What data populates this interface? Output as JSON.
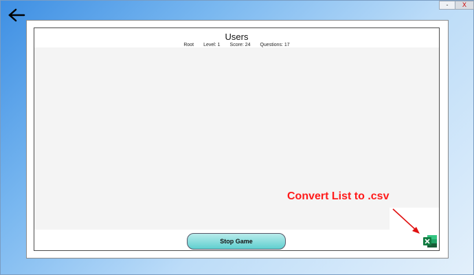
{
  "window": {
    "minimize_label": "-",
    "close_label": "X"
  },
  "icons": {
    "back": "back-arrow-icon",
    "export": "excel-icon"
  },
  "header": {
    "title": "Users",
    "user": "Root",
    "level": "Level: 1",
    "score": "Score: 24",
    "questions": "Questions: 17"
  },
  "buttons": {
    "stop_game": "Stop Game"
  },
  "annotation": {
    "text": "Convert List to .csv",
    "color": "#ff1a1a"
  },
  "colors": {
    "button_top": "#b9ecec",
    "button_bottom": "#5fcfcf",
    "background_start": "#3e8fe3",
    "excel_green": "#1f7a43"
  }
}
